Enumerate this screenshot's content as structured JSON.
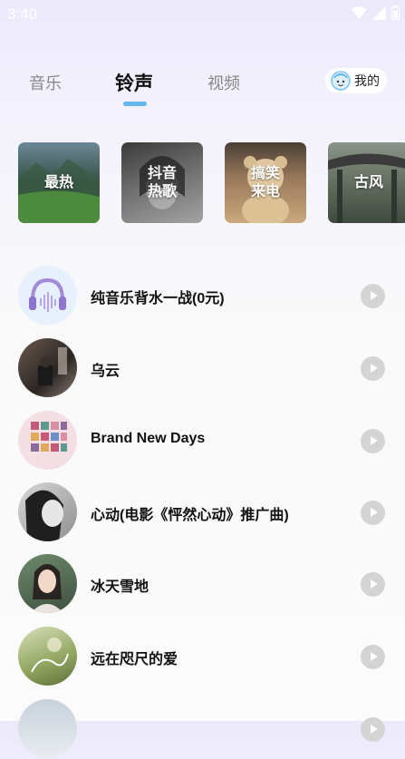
{
  "status": {
    "time": "3:40"
  },
  "tabs": [
    {
      "label": "音乐"
    },
    {
      "label": "铃声"
    },
    {
      "label": "视频"
    }
  ],
  "mine": {
    "label": "我的"
  },
  "categories": [
    {
      "label": "最热"
    },
    {
      "label": "抖音\n热歌"
    },
    {
      "label": "搞笑\n来电"
    },
    {
      "label": "古风"
    }
  ],
  "songs": [
    {
      "title": "纯音乐背水一战(0元)"
    },
    {
      "title": "乌云"
    },
    {
      "title": "Brand New Days"
    },
    {
      "title": "心动(电影《怦然心动》推广曲)"
    },
    {
      "title": "冰天雪地"
    },
    {
      "title": "远在咫尺的爱"
    }
  ],
  "colors": {
    "accent": "#66b5ee",
    "play_button": "#d4d4d4"
  }
}
